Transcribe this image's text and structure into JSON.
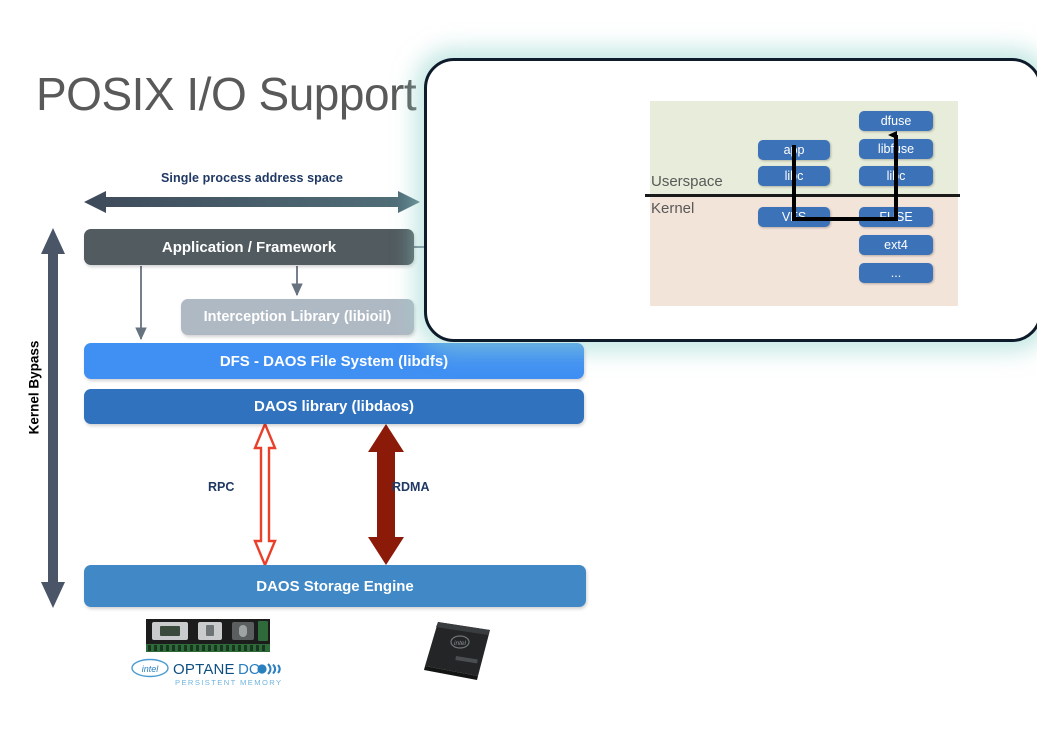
{
  "page": {
    "title": "POSIX I/O Support"
  },
  "colors": {
    "title_gray": "#595959",
    "app_box": "#515B60",
    "interception_box": "#AFB9C4",
    "dfs_box": "#4090F4",
    "daoslib_box": "#3072BE",
    "engine_box": "#4189C6",
    "dfuse_box": "#AAA5A5",
    "inset_block": "#3C72B8",
    "userspace_bg": "#E7EDDA",
    "kernel_bg": "#F3E4DA",
    "rpc_arrow": "#E8402A",
    "rdma_arrow": "#8B1A09",
    "kernel_bypass_arrow": "#4A5568",
    "address_arrow": "#4A5568",
    "callout_border": "#0D1B2A",
    "callout_glow": "#96D6CD",
    "label_navy": "#1F3864",
    "pink_arrow": "#C9707E"
  },
  "diagram": {
    "address_space_label": "Single process address space",
    "kernel_bypass_label": "Kernel Bypass",
    "boxes": {
      "application": "Application / Framework",
      "interception": "Interception Library (libioil)",
      "dfs": "DFS - DAOS File System (libdfs)",
      "daos_library": "DAOS library (libdaos)",
      "storage_engine": "DAOS Storage Engine",
      "dfuse": "dfuse"
    },
    "transport": {
      "rpc": "RPC",
      "rdma": "RDMA"
    },
    "hardware": {
      "dimm_alt": "intel-optane-dc-persistent-memory-dimm",
      "logo_intel": "intel",
      "logo_optane": "OPTANE",
      "logo_dc": "DC",
      "logo_subtitle": "PERSISTENT MEMORY",
      "ssd_alt": "intel-ssd"
    }
  },
  "callout": {
    "regions": {
      "userspace": "Userspace",
      "kernel": "Kernel"
    },
    "left_column": [
      {
        "label": "app",
        "region": "userspace"
      },
      {
        "label": "libc",
        "region": "userspace"
      },
      {
        "label": "VFS",
        "region": "kernel"
      }
    ],
    "right_column": [
      {
        "label": "dfuse",
        "region": "userspace"
      },
      {
        "label": "libfuse",
        "region": "userspace"
      },
      {
        "label": "libc",
        "region": "userspace"
      },
      {
        "label": "FUSE",
        "region": "kernel"
      },
      {
        "label": "ext4",
        "region": "kernel"
      },
      {
        "label": "...",
        "region": "kernel"
      }
    ]
  }
}
